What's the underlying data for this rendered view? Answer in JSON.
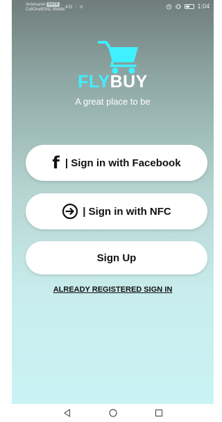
{
  "status_bar": {
    "carrier_line1": "Airtelsamit",
    "volte_badge": "VoLTE",
    "carrier_line2": "CellOneBSNL Mobile",
    "network_indicators": "4G ⫶ ᯤ",
    "icons": [
      "alarm-icon",
      "vibrate-icon",
      "battery-icon"
    ],
    "time": "1:04"
  },
  "brand": {
    "logo_icon": "shopping-cart-icon",
    "name_part1": "FLY",
    "name_part2": "BUY",
    "tagline": "A great place to be",
    "colors": {
      "fly": "#3ff0ff",
      "buy": "#ffffff",
      "cart": "#3ff0ff"
    }
  },
  "actions": {
    "facebook_label": "| Sign in with Facebook",
    "facebook_icon": "facebook-icon",
    "nfc_label": "| Sign in with NFC",
    "nfc_icon": "arrow-circle-right-icon",
    "signup_label": "Sign Up",
    "already_registered_label": "ALREADY REGISTERED SIGN IN"
  },
  "navigation_bar": {
    "icons": [
      "back-icon",
      "home-icon",
      "recents-icon"
    ]
  }
}
